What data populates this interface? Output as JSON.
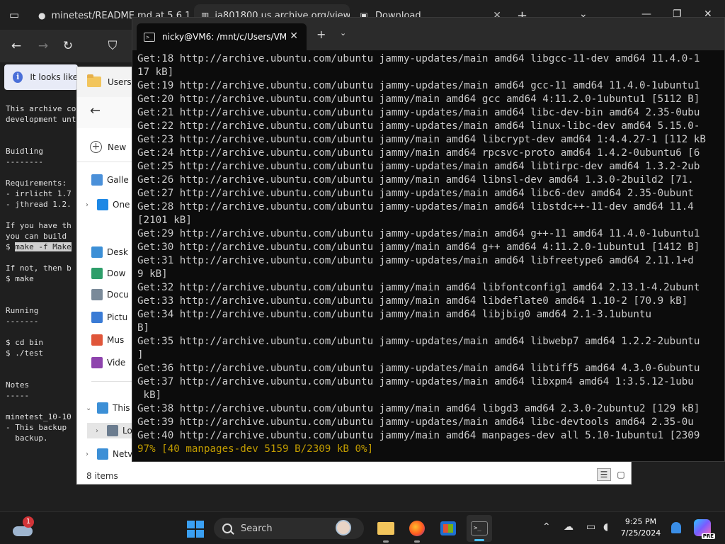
{
  "browser": {
    "tabs": [
      {
        "label": "minetest/README.md at 5.6.1 ·",
        "icon": "github-icon"
      },
      {
        "label": "ia801800.us.archive.org/view",
        "icon": "archive-icon"
      },
      {
        "label": "Download",
        "icon": "download-page-icon"
      }
    ],
    "infobar_text": "It looks like",
    "readme_lines": [
      "This archive co",
      "development unt",
      "",
      "",
      "Buidling",
      "--------",
      "",
      "Requirements:",
      "- irrlicht 1.7",
      "- jthread 1.2.",
      "",
      "If you have th",
      "you can build ",
      "",
      "",
      "If not, then b",
      "$ make",
      "",
      "",
      "Running",
      "-------",
      "",
      "$ cd bin",
      "$ ./test",
      "",
      "",
      "Notes",
      "-----",
      "",
      "minetest_10-10",
      "- This backup ",
      "  backup."
    ],
    "readme_cmd_prefix": "$ ",
    "readme_cmd_highlight": "make -f Make"
  },
  "explorer": {
    "title": "Users",
    "new_label": "New",
    "nav_items": [
      {
        "label": "Galle",
        "icon": "gallery-icon",
        "color": "#4a90d9",
        "chevron": false
      },
      {
        "label": "One",
        "icon": "onedrive-icon",
        "color": "#1e88e5",
        "chevron": true
      },
      {
        "label": "Desk",
        "icon": "desktop-icon",
        "color": "#3c8fd6",
        "chevron": false
      },
      {
        "label": "Dow",
        "icon": "downloads-icon",
        "color": "#2e9e6a",
        "chevron": false
      },
      {
        "label": "Docu",
        "icon": "documents-icon",
        "color": "#7a8a99",
        "chevron": false
      },
      {
        "label": "Pictu",
        "icon": "pictures-icon",
        "color": "#3a7bd5",
        "chevron": false
      },
      {
        "label": "Mus",
        "icon": "music-icon",
        "color": "#e0563a",
        "chevron": false
      },
      {
        "label": "Vide",
        "icon": "videos-icon",
        "color": "#8e44ad",
        "chevron": false
      },
      {
        "label": "This",
        "icon": "this-pc-icon",
        "color": "#3c8fd6",
        "chevron": true,
        "expanded": true
      },
      {
        "label": "Lo",
        "icon": "local-disk-icon",
        "color": "#6b7c8f",
        "chevron": true,
        "selected": true
      },
      {
        "label": "Netv",
        "icon": "network-icon",
        "color": "#3c8fd6",
        "chevron": true
      }
    ],
    "status": "8 items"
  },
  "terminal": {
    "tab_title": "nicky@VM6: /mnt/c/Users/VM",
    "lines": [
      "Get:18 http://archive.ubuntu.com/ubuntu jammy-updates/main amd64 libgcc-11-dev amd64 11.4.0-1",
      "17 kB]",
      "Get:19 http://archive.ubuntu.com/ubuntu jammy-updates/main amd64 gcc-11 amd64 11.4.0-1ubuntu1",
      "Get:20 http://archive.ubuntu.com/ubuntu jammy/main amd64 gcc amd64 4:11.2.0-1ubuntu1 [5112 B]",
      "Get:21 http://archive.ubuntu.com/ubuntu jammy-updates/main amd64 libc-dev-bin amd64 2.35-0ubu",
      "Get:22 http://archive.ubuntu.com/ubuntu jammy-updates/main amd64 linux-libc-dev amd64 5.15.0-",
      "Get:23 http://archive.ubuntu.com/ubuntu jammy/main amd64 libcrypt-dev amd64 1:4.4.27-1 [112 kB",
      "Get:24 http://archive.ubuntu.com/ubuntu jammy/main amd64 rpcsvc-proto amd64 1.4.2-0ubuntu6 [6",
      "Get:25 http://archive.ubuntu.com/ubuntu jammy-updates/main amd64 libtirpc-dev amd64 1.3.2-2ub",
      "Get:26 http://archive.ubuntu.com/ubuntu jammy/main amd64 libnsl-dev amd64 1.3.0-2build2 [71.",
      "Get:27 http://archive.ubuntu.com/ubuntu jammy-updates/main amd64 libc6-dev amd64 2.35-0ubunt",
      "Get:28 http://archive.ubuntu.com/ubuntu jammy-updates/main amd64 libstdc++-11-dev amd64 11.4",
      "[2101 kB]",
      "Get:29 http://archive.ubuntu.com/ubuntu jammy-updates/main amd64 g++-11 amd64 11.4.0-1ubuntu1",
      "Get:30 http://archive.ubuntu.com/ubuntu jammy/main amd64 g++ amd64 4:11.2.0-1ubuntu1 [1412 B]",
      "Get:31 http://archive.ubuntu.com/ubuntu jammy-updates/main amd64 libfreetype6 amd64 2.11.1+d",
      "9 kB]",
      "Get:32 http://archive.ubuntu.com/ubuntu jammy/main amd64 libfontconfig1 amd64 2.13.1-4.2ubunt",
      "Get:33 http://archive.ubuntu.com/ubuntu jammy/main amd64 libdeflate0 amd64 1.10-2 [70.9 kB]",
      "Get:34 http://archive.ubuntu.com/ubuntu jammy/main amd64 libjbig0 amd64 2.1-3.1ubuntu",
      "B]",
      "Get:35 http://archive.ubuntu.com/ubuntu jammy-updates/main amd64 libwebp7 amd64 1.2.2-2ubuntu",
      "]",
      "Get:36 http://archive.ubuntu.com/ubuntu jammy-updates/main amd64 libtiff5 amd64 4.3.0-6ubuntu",
      "Get:37 http://archive.ubuntu.com/ubuntu jammy-updates/main amd64 libxpm4 amd64 1:3.5.12-1ubu",
      " kB]",
      "Get:38 http://archive.ubuntu.com/ubuntu jammy/main amd64 libgd3 amd64 2.3.0-2ubuntu2 [129 kB]",
      "Get:39 http://archive.ubuntu.com/ubuntu jammy-updates/main amd64 libc-devtools amd64 2.35-0u",
      "Get:40 http://archive.ubuntu.com/ubuntu jammy/main amd64 manpages-dev all 5.10-1ubuntu1 [2309"
    ],
    "progress_line": "97% [40 manpages-dev 5159 B/2309 kB 0%]",
    "progress_color": "#c19c00"
  },
  "taskbar": {
    "weather_badge": "1",
    "search_placeholder": "Search",
    "time": "9:25 PM",
    "date": "7/25/2024",
    "copilot_badge": "PRE"
  },
  "colors": {
    "accent": "#4cc2ff",
    "terminal_bg": "#0c0c0c",
    "terminal_fg": "#cccccc"
  }
}
